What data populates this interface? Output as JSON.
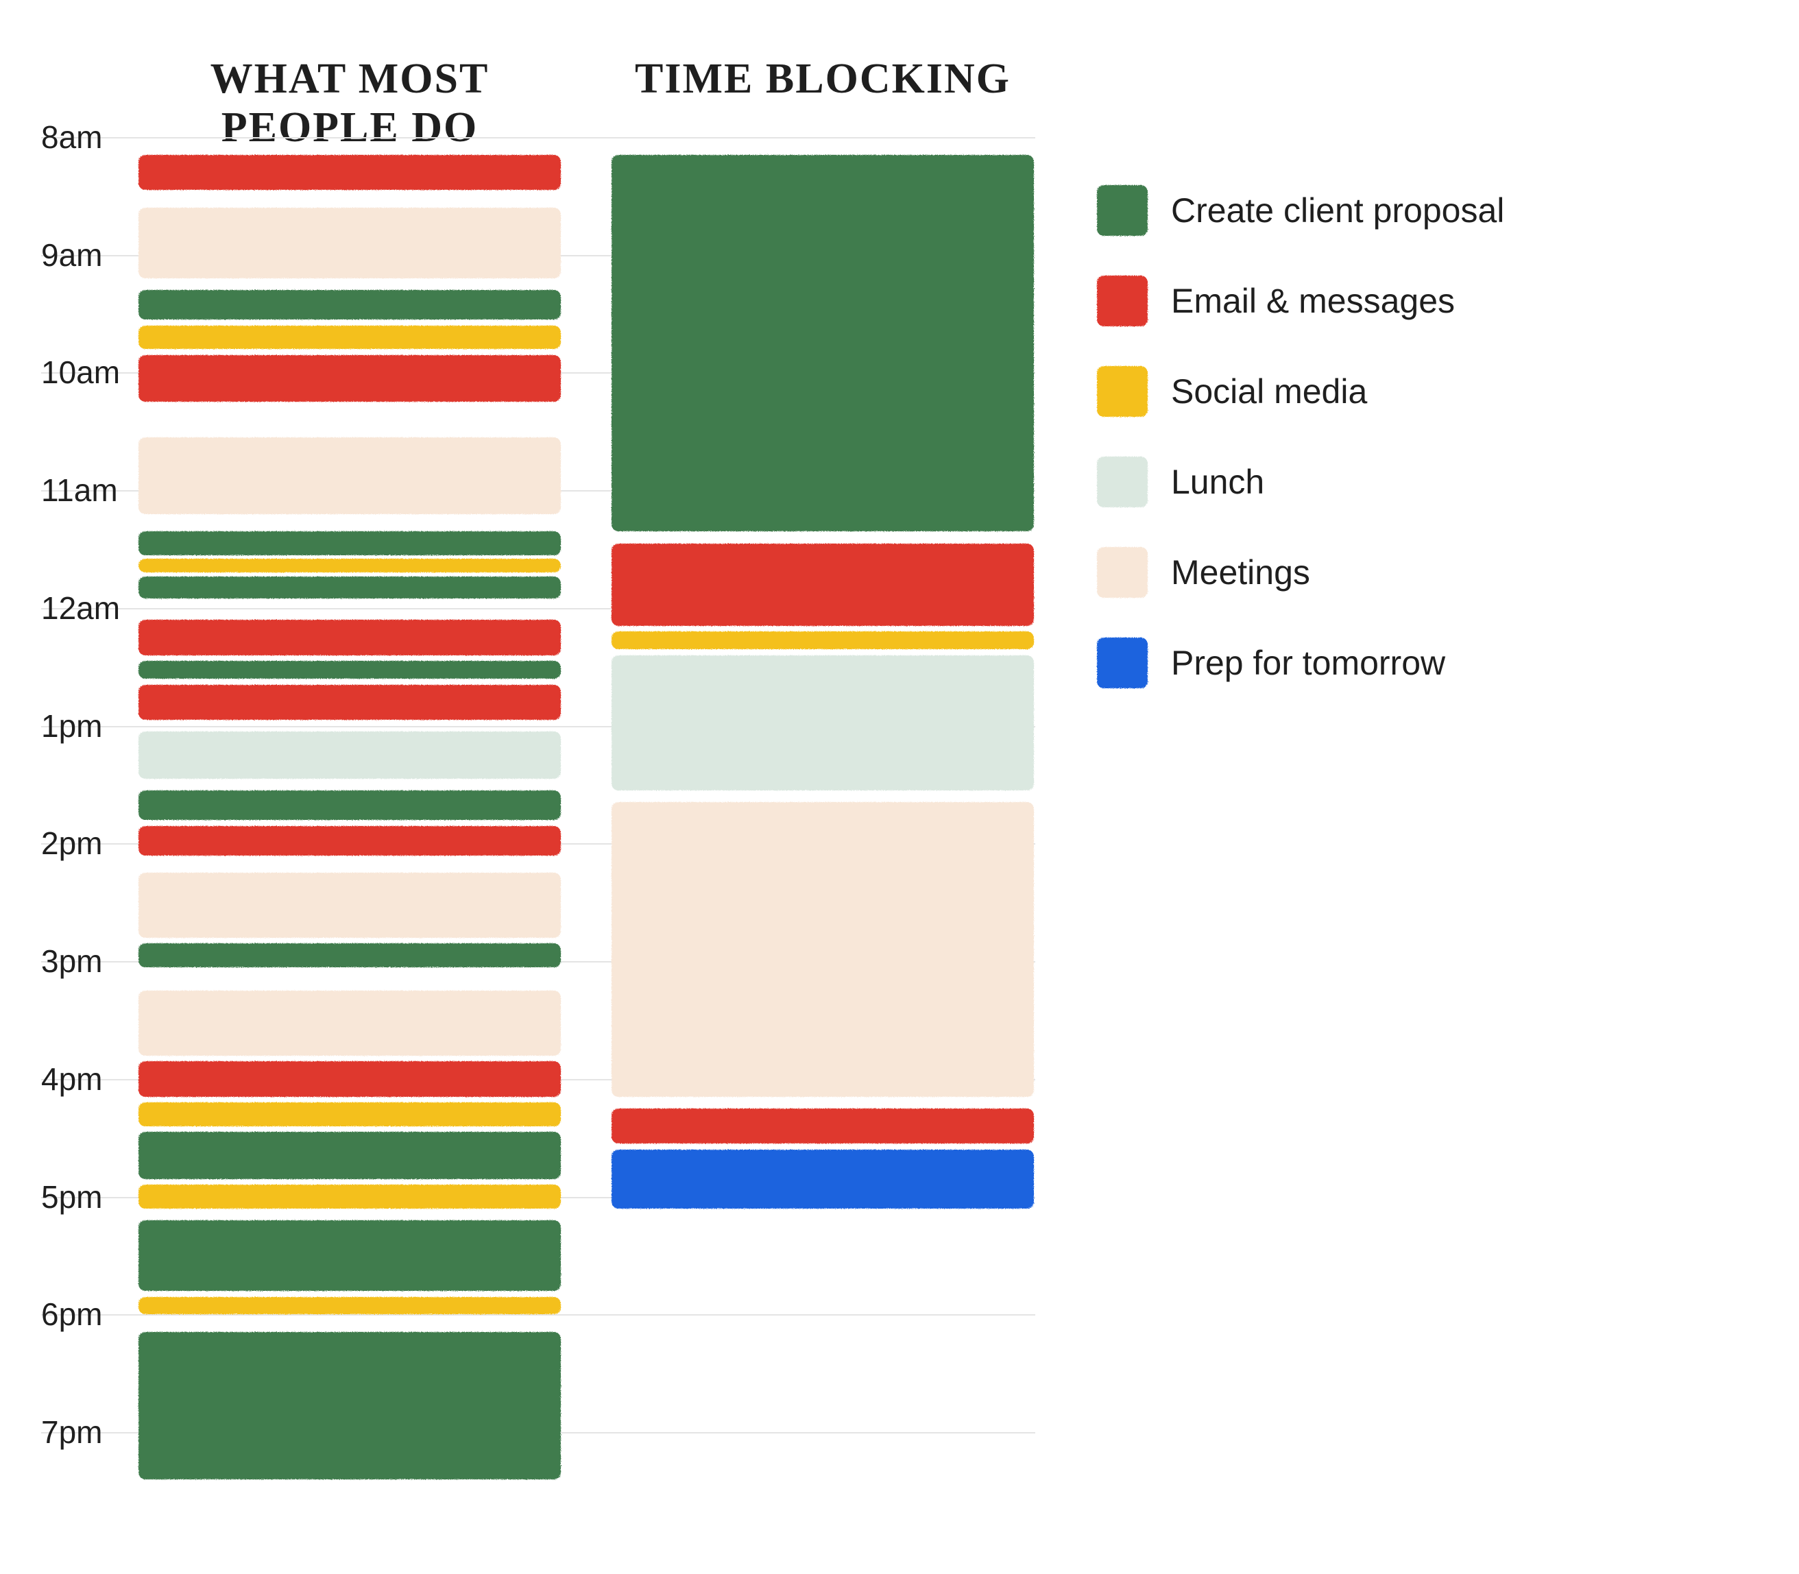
{
  "headers": {
    "left": "WHAT MOST PEOPLE DO",
    "right": "TIME BLOCKING"
  },
  "axis_labels": [
    {
      "t": 8,
      "text": "8am"
    },
    {
      "t": 9,
      "text": "9am"
    },
    {
      "t": 10,
      "text": "10am"
    },
    {
      "t": 11,
      "text": "11am"
    },
    {
      "t": 12,
      "text": "12am"
    },
    {
      "t": 13,
      "text": "1pm"
    },
    {
      "t": 14,
      "text": "2pm"
    },
    {
      "t": 15,
      "text": "3pm"
    },
    {
      "t": 16,
      "text": "4pm"
    },
    {
      "t": 17,
      "text": "5pm"
    },
    {
      "t": 18,
      "text": "6pm"
    },
    {
      "t": 19,
      "text": "7pm"
    }
  ],
  "categories": {
    "green": {
      "label": "Create client proposal",
      "color": "#3f7c4e"
    },
    "red": {
      "label": "Email & messages",
      "color": "#df372f"
    },
    "yellow": {
      "label": "Social media",
      "color": "#f4c01f"
    },
    "lunch": {
      "label": "Lunch",
      "color": "#dbe8e0"
    },
    "pink": {
      "label": "Meetings",
      "color": "#f8e7d8"
    },
    "blue": {
      "label": "Prep for tomorrow",
      "color": "#1f64de"
    }
  },
  "legend_order": [
    "green",
    "red",
    "yellow",
    "lunch",
    "pink",
    "blue"
  ],
  "chart_data": {
    "type": "bar",
    "orientation": "vertical-timeline",
    "y_axis": {
      "unit": "hour-of-day",
      "start": 8,
      "end": 19.5,
      "tick_step": 1
    },
    "columns": [
      "What most people do",
      "Time blocking"
    ],
    "series_left": [
      {
        "cat": "red",
        "start": 8.15,
        "end": 8.45
      },
      {
        "cat": "pink",
        "start": 8.6,
        "end": 9.2
      },
      {
        "cat": "green",
        "start": 9.3,
        "end": 9.55
      },
      {
        "cat": "yellow",
        "start": 9.6,
        "end": 9.8
      },
      {
        "cat": "red",
        "start": 9.85,
        "end": 10.25
      },
      {
        "cat": "pink",
        "start": 10.55,
        "end": 11.2
      },
      {
        "cat": "green",
        "start": 11.35,
        "end": 11.55
      },
      {
        "cat": "yellow",
        "start": 11.58,
        "end": 11.7
      },
      {
        "cat": "green",
        "start": 11.73,
        "end": 11.92
      },
      {
        "cat": "red",
        "start": 12.1,
        "end": 12.4
      },
      {
        "cat": "green",
        "start": 12.45,
        "end": 12.6
      },
      {
        "cat": "red",
        "start": 12.65,
        "end": 12.95
      },
      {
        "cat": "lunch",
        "start": 13.05,
        "end": 13.45
      },
      {
        "cat": "green",
        "start": 13.55,
        "end": 13.8
      },
      {
        "cat": "red",
        "start": 13.85,
        "end": 14.1
      },
      {
        "cat": "pink",
        "start": 14.25,
        "end": 14.8
      },
      {
        "cat": "green",
        "start": 14.85,
        "end": 15.05
      },
      {
        "cat": "pink",
        "start": 15.25,
        "end": 15.8
      },
      {
        "cat": "red",
        "start": 15.85,
        "end": 16.15
      },
      {
        "cat": "yellow",
        "start": 16.2,
        "end": 16.4
      },
      {
        "cat": "green",
        "start": 16.45,
        "end": 16.85
      },
      {
        "cat": "yellow",
        "start": 16.9,
        "end": 17.1
      },
      {
        "cat": "green",
        "start": 17.2,
        "end": 17.8
      },
      {
        "cat": "yellow",
        "start": 17.85,
        "end": 18.0
      },
      {
        "cat": "green",
        "start": 18.15,
        "end": 19.4
      }
    ],
    "series_right": [
      {
        "cat": "green",
        "start": 8.15,
        "end": 11.35
      },
      {
        "cat": "red",
        "start": 11.45,
        "end": 12.15
      },
      {
        "cat": "yellow",
        "start": 12.2,
        "end": 12.35
      },
      {
        "cat": "lunch",
        "start": 12.4,
        "end": 13.55
      },
      {
        "cat": "pink",
        "start": 13.65,
        "end": 16.15
      },
      {
        "cat": "red",
        "start": 16.25,
        "end": 16.55
      },
      {
        "cat": "blue",
        "start": 16.6,
        "end": 17.1
      }
    ]
  }
}
